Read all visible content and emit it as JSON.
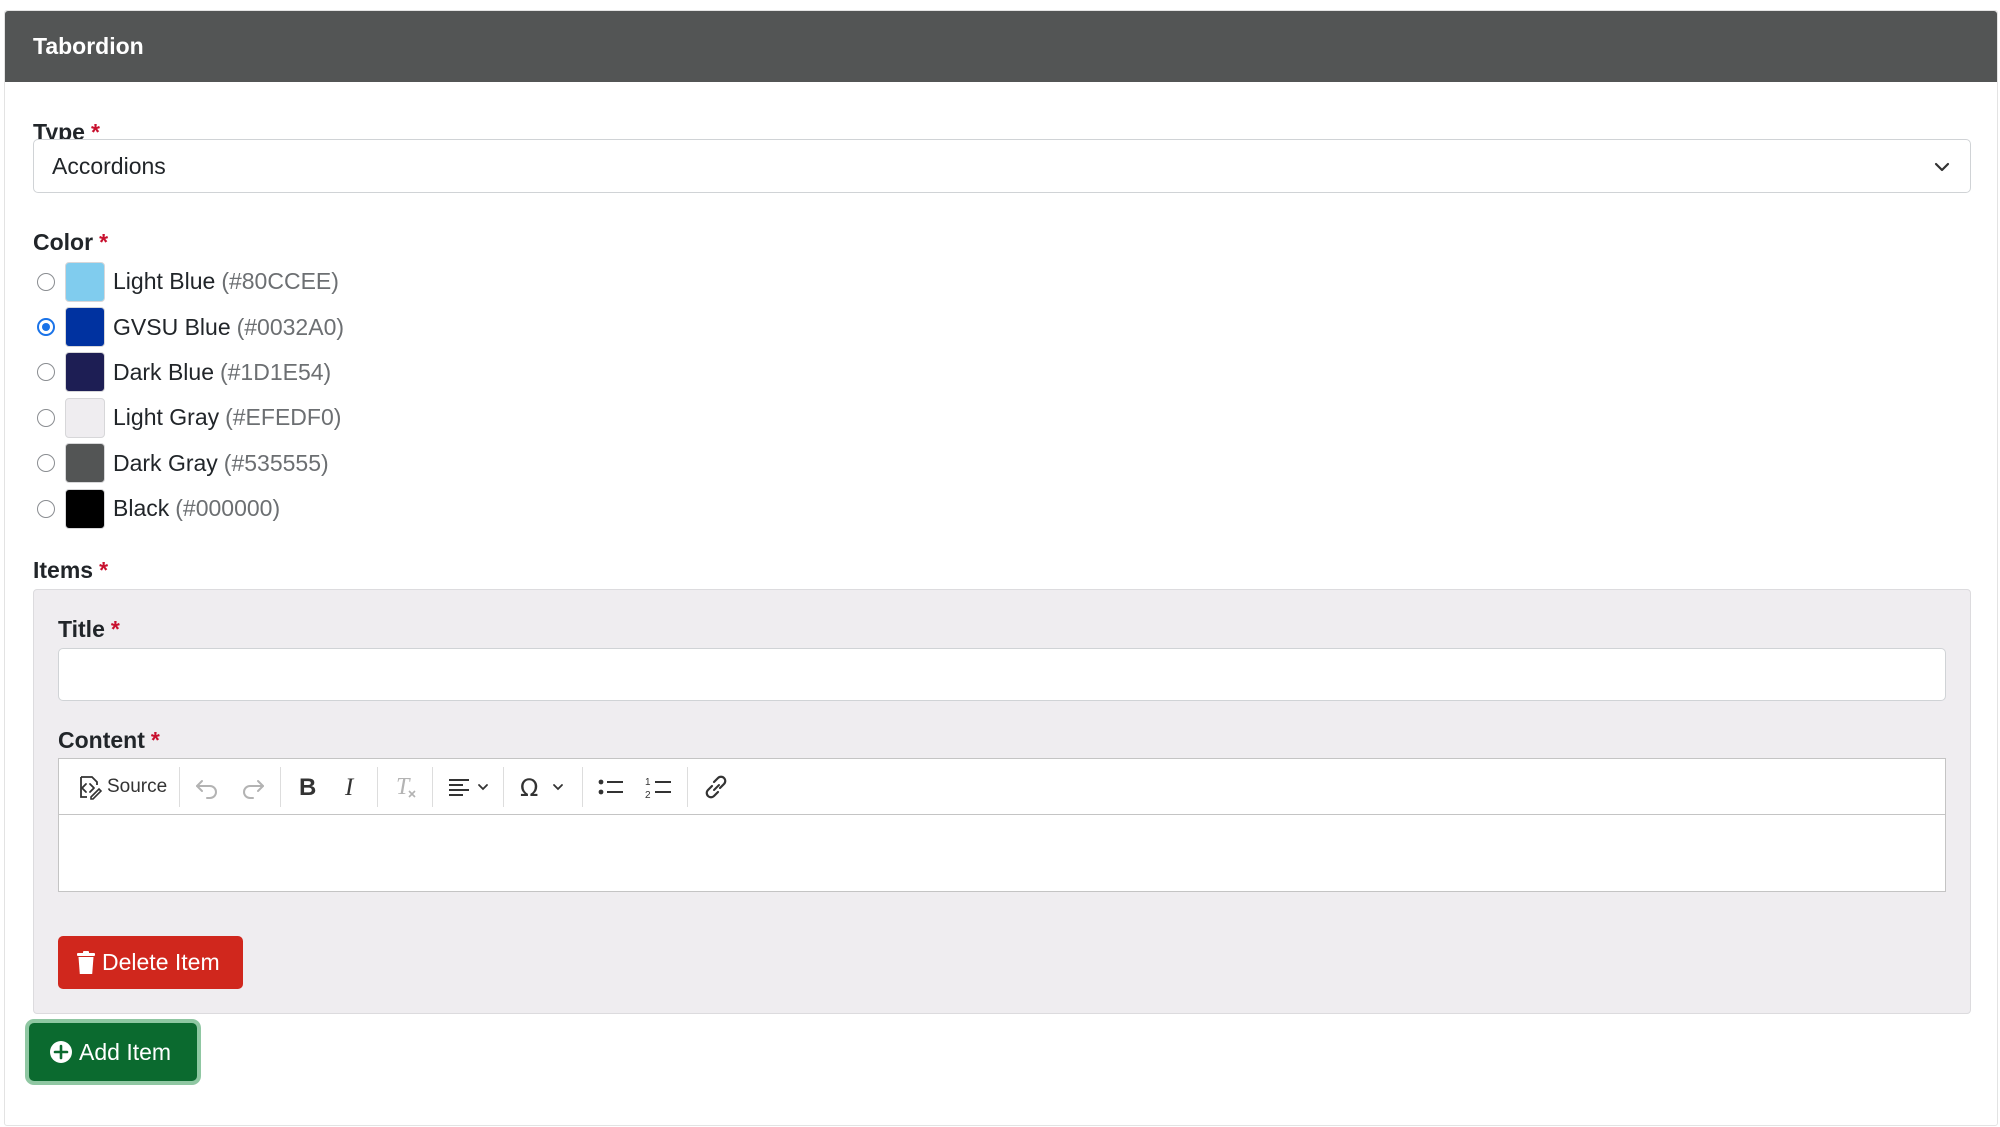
{
  "panel": {
    "title": "Tabordion"
  },
  "type_field": {
    "label": "Type",
    "required": "*",
    "value": "Accordions",
    "chevron_icon": "chevron-down-icon"
  },
  "color_field": {
    "label": "Color",
    "required": "*",
    "options": [
      {
        "name": "Light Blue",
        "hex": "(#80CCEE)",
        "color": "#80CCEE",
        "checked": false
      },
      {
        "name": "GVSU Blue",
        "hex": "(#0032A0)",
        "color": "#0032A0",
        "checked": true
      },
      {
        "name": "Dark Blue",
        "hex": "(#1D1E54)",
        "color": "#1D1E54",
        "checked": false
      },
      {
        "name": "Light Gray",
        "hex": "(#EFEDF0)",
        "color": "#EFEDF0",
        "checked": false
      },
      {
        "name": "Dark Gray",
        "hex": "(#535555)",
        "color": "#535555",
        "checked": false
      },
      {
        "name": "Black",
        "hex": "(#000000)",
        "color": "#000000",
        "checked": false
      }
    ]
  },
  "items_field": {
    "label": "Items",
    "required": "*",
    "item": {
      "title_label": "Title",
      "title_required": "*",
      "title_value": "",
      "content_label": "Content",
      "content_required": "*",
      "toolbar": {
        "source_label": "Source",
        "icons": [
          "source-icon",
          "undo-icon",
          "redo-icon",
          "bold-icon",
          "italic-icon",
          "remove-format-icon",
          "align-icon",
          "special-char-icon",
          "bulleted-list-icon",
          "numbered-list-icon",
          "link-icon"
        ]
      },
      "delete_label": "Delete Item"
    }
  },
  "add_item": {
    "label": "Add Item"
  },
  "colors": {
    "header_bg": "#535555",
    "danger": "#D0271D",
    "success": "#0B6A2F",
    "required": "#C8102E",
    "radio_checked": "#1A73E8"
  }
}
